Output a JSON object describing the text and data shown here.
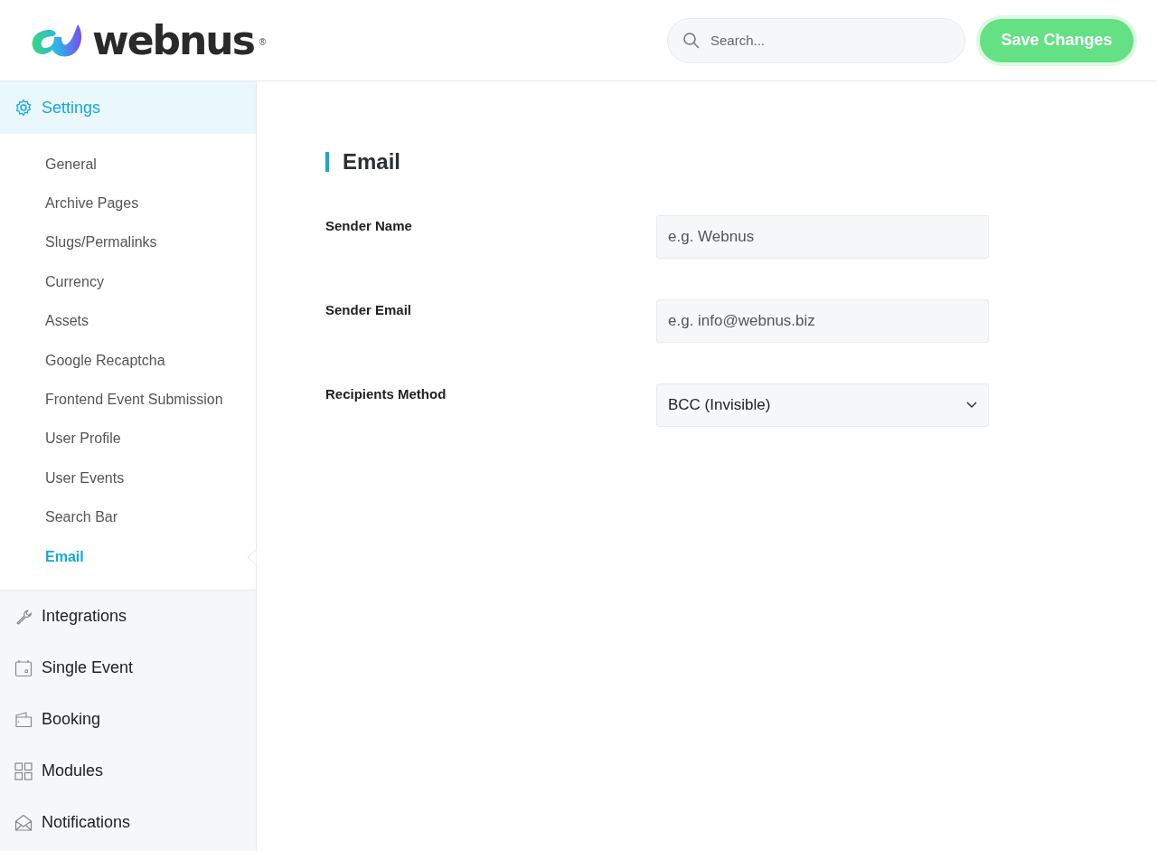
{
  "header": {
    "logo": {
      "text": "webnus",
      "mark": "®"
    },
    "search": {
      "placeholder": "Search..."
    },
    "save_button": "Save Changes"
  },
  "sidebar": {
    "sections": [
      {
        "label": "Settings",
        "expanded": true,
        "children": [
          {
            "label": "General",
            "selected": false
          },
          {
            "label": "Archive Pages",
            "selected": false
          },
          {
            "label": "Slugs/Permalinks",
            "selected": false
          },
          {
            "label": "Currency",
            "selected": false
          },
          {
            "label": "Assets",
            "selected": false
          },
          {
            "label": "Google Recaptcha",
            "selected": false
          },
          {
            "label": "Frontend Event Submission",
            "selected": false
          },
          {
            "label": "User Profile",
            "selected": false
          },
          {
            "label": "User Events",
            "selected": false
          },
          {
            "label": "Search Bar",
            "selected": false
          },
          {
            "label": "Email",
            "selected": true
          }
        ]
      },
      {
        "label": "Integrations",
        "expanded": false
      },
      {
        "label": "Single Event",
        "expanded": false
      },
      {
        "label": "Booking",
        "expanded": false
      },
      {
        "label": "Modules",
        "expanded": false
      },
      {
        "label": "Notifications",
        "expanded": false
      }
    ]
  },
  "panel": {
    "title": "Email",
    "fields": [
      {
        "kind": "text",
        "label": "Sender Name",
        "placeholder": "e.g. Webnus"
      },
      {
        "kind": "text",
        "label": "Sender Email",
        "placeholder": "e.g. info@webnus.biz"
      },
      {
        "kind": "select",
        "label": "Recipients Method",
        "value": "BCC (Invisible)"
      }
    ]
  }
}
